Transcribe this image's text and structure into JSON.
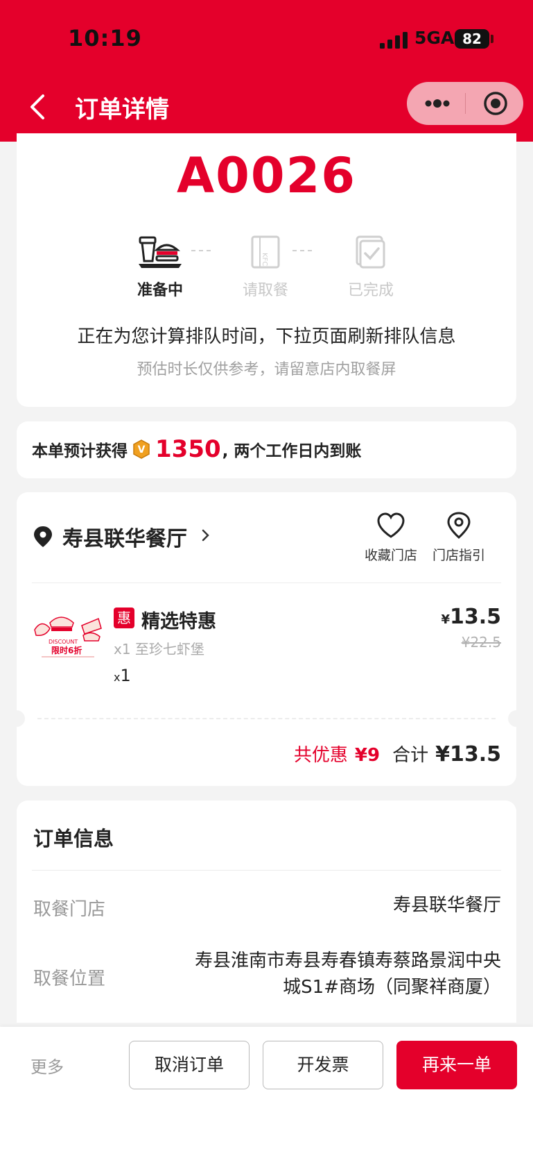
{
  "status_bar": {
    "time": "10:19",
    "network": "5GA",
    "battery": "82"
  },
  "nav": {
    "title": "订单详情"
  },
  "order": {
    "number": "A0026",
    "steps": [
      {
        "label": "准备中",
        "active": true
      },
      {
        "label": "请取餐",
        "active": false
      },
      {
        "label": "已完成",
        "active": false
      }
    ],
    "message": "正在为您计算排队时间，下拉页面刷新排队信息",
    "sub_message": "预估时长仅供参考，请留意店内取餐屏"
  },
  "points": {
    "prefix": "本单预计获得",
    "value": "1350",
    "suffix": ", 两个工作日内到账"
  },
  "store": {
    "name": "寿县联华餐厅",
    "favorite_label": "收藏门店",
    "guide_label": "门店指引",
    "item": {
      "badge": "惠",
      "name": "精选特惠",
      "detail": "x1 至珍七虾堡",
      "qty_x": "x",
      "qty": "1",
      "price_symbol": "¥",
      "price": "13.5",
      "original_price": "¥22.5",
      "promo_text_1": "DISCOUNT",
      "promo_text_2": "限时6折"
    },
    "discount_label": "共优惠",
    "discount_value": "¥9",
    "total_label": "合计",
    "total_value": "¥13.5"
  },
  "info": {
    "title": "订单信息",
    "pickup_store_label": "取餐门店",
    "pickup_store_value": "寿县联华餐厅",
    "pickup_location_label": "取餐位置",
    "pickup_location_line1": "寿县淮南市寿县寿春镇寿蔡路景润中央",
    "pickup_location_line2": "城S1#商场（同聚祥商厦）"
  },
  "actions": {
    "more": "更多",
    "cancel": "取消订单",
    "invoice": "开发票",
    "reorder": "再来一单"
  },
  "colors": {
    "brand_red": "#e4002b",
    "capsule": "#f4a6b2",
    "coin": "#f0a020"
  }
}
